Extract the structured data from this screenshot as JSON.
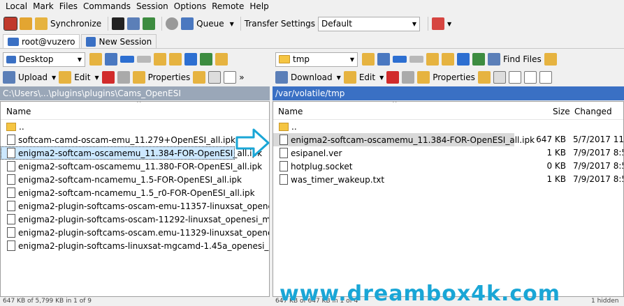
{
  "menu": [
    "Local",
    "Mark",
    "Files",
    "Commands",
    "Session",
    "Options",
    "Remote",
    "Help"
  ],
  "toolbar": {
    "synchronize": "Synchronize",
    "queue": "Queue",
    "transfer_label": "Transfer Settings",
    "transfer_value": "Default"
  },
  "tabs": [
    {
      "label": "root@vuzero"
    },
    {
      "label": "New Session"
    }
  ],
  "left": {
    "location": "Desktop",
    "upload": "Upload",
    "edit": "Edit",
    "properties": "Properties",
    "path": "C:\\Users\\...\\plugins\\plugins\\Cams_OpenESI",
    "col_name": "Name",
    "files": [
      {
        "name": ".."
      },
      {
        "name": "softcam-camd-oscam-emu_11.279+OpenESI_all.ipk"
      },
      {
        "name": "enigma2-softcam-oscamemu_11.384-FOR-OpenESI_all.ipk"
      },
      {
        "name": "enigma2-softcam-oscamemu_11.380-FOR-OpenESI_all.ipk"
      },
      {
        "name": "enigma2-softcam-ncamemu_1.5-FOR-OpenESI_all.ipk"
      },
      {
        "name": "enigma2-softcam-ncamemu_1.5_r0-FOR-OpenESI_all.ipk"
      },
      {
        "name": "enigma2-plugin-softcams-oscam-emu-11357-linuxsat_openesi_mi..."
      },
      {
        "name": "enigma2-plugin-softcams-oscam-11292-linuxsat_openesi_mips32el"
      },
      {
        "name": "enigma2-plugin-softcams-oscam.emu-11329-linuxsat_openesi_mip"
      },
      {
        "name": "enigma2-plugin-softcams-linuxsat-mgcamd-1.45a_openesi_mips32"
      }
    ],
    "status": "647 KB of 5,799 KB in 1 of 9"
  },
  "right": {
    "location": "tmp",
    "find": "Find Files",
    "download": "Download",
    "edit": "Edit",
    "properties": "Properties",
    "path": "/var/volatile/tmp",
    "col_name": "Name",
    "col_size": "Size",
    "col_changed": "Changed",
    "files": [
      {
        "name": "..",
        "size": "",
        "changed": ""
      },
      {
        "name": "enigma2-softcam-oscamemu_11.384-FOR-OpenESI_all.ipk",
        "size": "647 KB",
        "changed": "5/7/2017 11:5"
      },
      {
        "name": "esipanel.ver",
        "size": "1 KB",
        "changed": "7/9/2017 8:50"
      },
      {
        "name": "hotplug.socket",
        "size": "0 KB",
        "changed": "7/9/2017 8:50"
      },
      {
        "name": "was_timer_wakeup.txt",
        "size": "1 KB",
        "changed": "7/9/2017 8:50"
      }
    ],
    "status": "647 KB of 647 KB in 1 of 4",
    "status_right": "1 hidden"
  },
  "watermark": "www.dreambox4k.com",
  "colors": {
    "path_active": "#3a70c4",
    "path_inactive": "#9aa7b8",
    "selected": "#cce8ff",
    "watermark": "#1aa6d6"
  }
}
